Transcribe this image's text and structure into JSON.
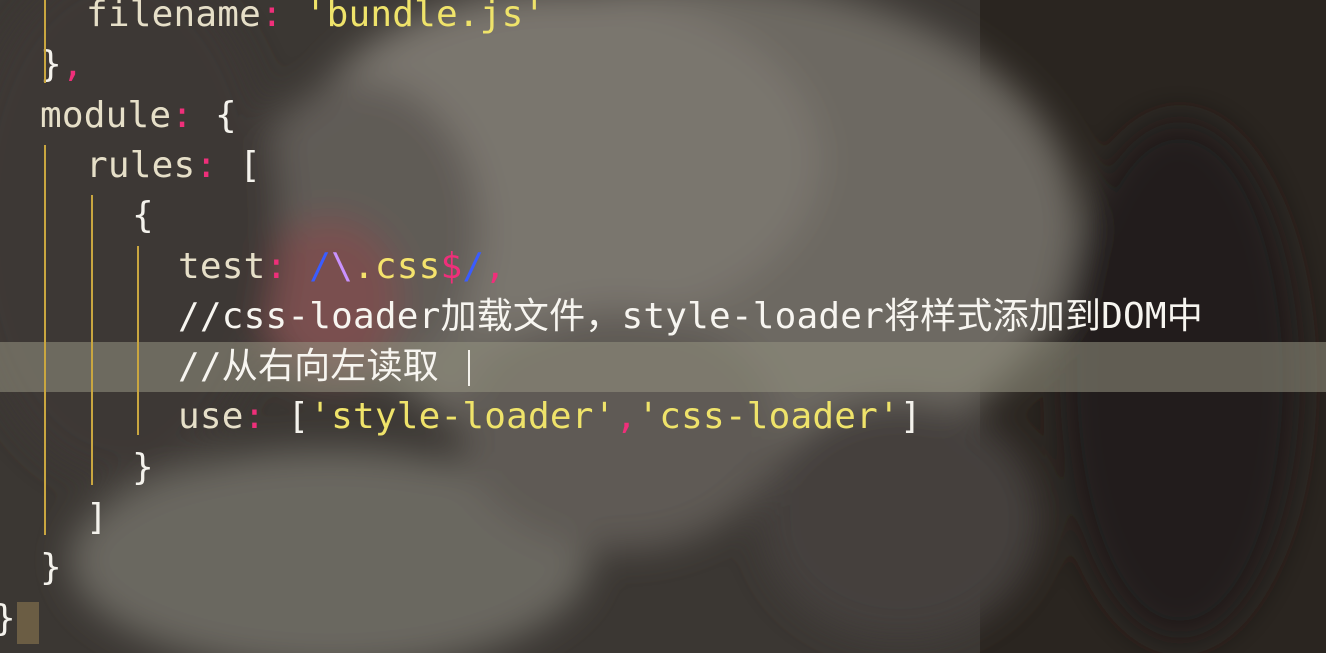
{
  "editor": {
    "lines": [
      {
        "indent": 2,
        "tokens": [
          {
            "t": "filename",
            "c": "key"
          },
          {
            "t": ": ",
            "c": "punct"
          },
          {
            "t": "'bundle.js'",
            "c": "str"
          }
        ]
      },
      {
        "indent": 1,
        "tokens": [
          {
            "t": "}",
            "c": "brace"
          },
          {
            "t": ",",
            "c": "punct"
          }
        ]
      },
      {
        "indent": 1,
        "tokens": [
          {
            "t": "module",
            "c": "key"
          },
          {
            "t": ": ",
            "c": "punct"
          },
          {
            "t": "{",
            "c": "brace"
          }
        ]
      },
      {
        "indent": 2,
        "tokens": [
          {
            "t": "rules",
            "c": "key"
          },
          {
            "t": ": ",
            "c": "punct"
          },
          {
            "t": "[",
            "c": "brace"
          }
        ]
      },
      {
        "indent": 3,
        "tokens": [
          {
            "t": "{",
            "c": "brace"
          }
        ]
      },
      {
        "indent": 4,
        "tokens": [
          {
            "t": "test",
            "c": "key"
          },
          {
            "t": ": ",
            "c": "punct"
          },
          {
            "t": "/",
            "c": "regex-slash"
          },
          {
            "t": "\\",
            "c": "regex-esc"
          },
          {
            "t": ".css",
            "c": "regex-body"
          },
          {
            "t": "$",
            "c": "regex-dollar"
          },
          {
            "t": "/",
            "c": "regex-slash"
          },
          {
            "t": ",",
            "c": "punct"
          }
        ]
      },
      {
        "indent": 4,
        "tokens": [
          {
            "t": "//css-loader加载文件，style-loader将样式添加到DOM中",
            "c": "comment"
          }
        ]
      },
      {
        "indent": 4,
        "current": true,
        "tokens": [
          {
            "t": "//从右向左读取",
            "c": "comment"
          }
        ]
      },
      {
        "indent": 4,
        "tokens": [
          {
            "t": "use",
            "c": "key"
          },
          {
            "t": ": ",
            "c": "punct"
          },
          {
            "t": "[",
            "c": "brace"
          },
          {
            "t": "'style-loader'",
            "c": "str"
          },
          {
            "t": ",",
            "c": "punct"
          },
          {
            "t": "'css-loader'",
            "c": "str"
          },
          {
            "t": "]",
            "c": "brace"
          }
        ]
      },
      {
        "indent": 3,
        "tokens": [
          {
            "t": "}",
            "c": "brace"
          }
        ]
      },
      {
        "indent": 2,
        "tokens": [
          {
            "t": "]",
            "c": "brace"
          }
        ]
      },
      {
        "indent": 1,
        "tokens": [
          {
            "t": "}",
            "c": "brace"
          }
        ]
      },
      {
        "indent": 0,
        "tokens": [
          {
            "t": "}",
            "c": "brace"
          }
        ]
      }
    ]
  }
}
